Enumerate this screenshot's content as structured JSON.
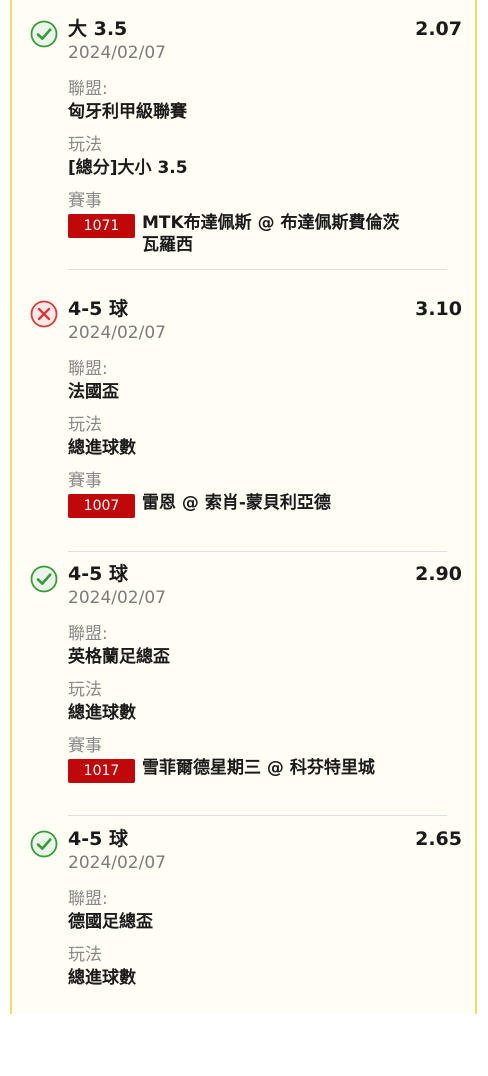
{
  "labels": {
    "league": "聯盟:",
    "play": "玩法",
    "event": "賽事"
  },
  "colors": {
    "win": "#3a9a3a",
    "lose": "#d83a3a",
    "badge": "#c0080b",
    "border": "#f0dc63"
  },
  "bets": [
    {
      "status": "win",
      "status_icon": "check-circle-icon",
      "selection": "大 3.5",
      "odds": "2.07",
      "date": "2024/02/07",
      "league": "匈牙利甲級聯賽",
      "play_type": "[總分]大小 3.5",
      "event_id": "1071",
      "event_name": "MTK布達佩斯 @ 布達佩斯費倫茨瓦羅西"
    },
    {
      "status": "lose",
      "status_icon": "x-circle-icon",
      "selection": "4-5 球",
      "odds": "3.10",
      "date": "2024/02/07",
      "league": "法國盃",
      "play_type": "總進球數",
      "event_id": "1007",
      "event_name": "雷恩 @ 索肖-蒙貝利亞德"
    },
    {
      "status": "win",
      "status_icon": "check-circle-icon",
      "selection": "4-5 球",
      "odds": "2.90",
      "date": "2024/02/07",
      "league": "英格蘭足總盃",
      "play_type": "總進球數",
      "event_id": "1017",
      "event_name": "雪菲爾德星期三 @ 科芬特里城"
    },
    {
      "status": "win",
      "status_icon": "check-circle-icon",
      "selection": "4-5 球",
      "odds": "2.65",
      "date": "2024/02/07",
      "league": "德國足總盃",
      "play_type": "總進球數"
    }
  ]
}
